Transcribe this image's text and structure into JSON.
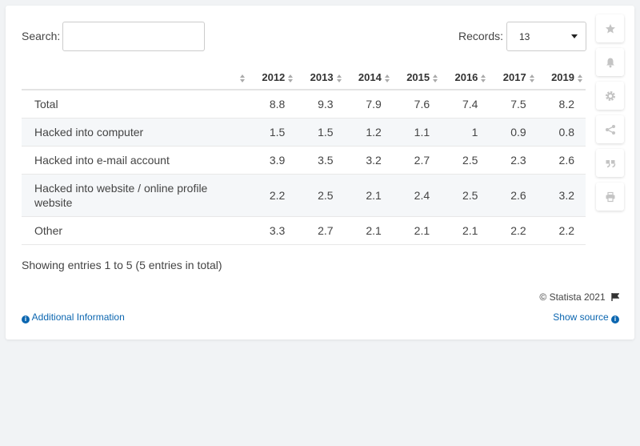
{
  "search": {
    "label": "Search:",
    "value": ""
  },
  "records": {
    "label": "Records:",
    "selected": "13"
  },
  "table": {
    "headers": [
      "",
      "2012",
      "2013",
      "2014",
      "2015",
      "2016",
      "2017",
      "2019"
    ],
    "rows": [
      {
        "label": "Total",
        "values": [
          "8.8",
          "9.3",
          "7.9",
          "7.6",
          "7.4",
          "7.5",
          "8.2"
        ]
      },
      {
        "label": "Hacked into computer",
        "values": [
          "1.5",
          "1.5",
          "1.2",
          "1.1",
          "1",
          "0.9",
          "0.8"
        ]
      },
      {
        "label": "Hacked into e-mail account",
        "values": [
          "3.9",
          "3.5",
          "3.2",
          "2.7",
          "2.5",
          "2.3",
          "2.6"
        ]
      },
      {
        "label": "Hacked into website / online profile website",
        "values": [
          "2.2",
          "2.5",
          "2.1",
          "2.4",
          "2.5",
          "2.6",
          "3.2"
        ]
      },
      {
        "label": "Other",
        "values": [
          "3.3",
          "2.7",
          "2.1",
          "2.1",
          "2.1",
          "2.2",
          "2.2"
        ]
      }
    ]
  },
  "footer": {
    "showing": "Showing entries 1 to 5 (5 entries in total)",
    "copyright": "© Statista 2021",
    "additional_info": "Additional Information",
    "show_source": "Show source"
  },
  "sidebar": [
    "star-icon",
    "bell-icon",
    "gear-icon",
    "share-icon",
    "quote-icon",
    "print-icon"
  ],
  "colors": {
    "link": "#0b66b0",
    "icon": "#c4c4c4",
    "row_alt": "#f5f7f9"
  }
}
